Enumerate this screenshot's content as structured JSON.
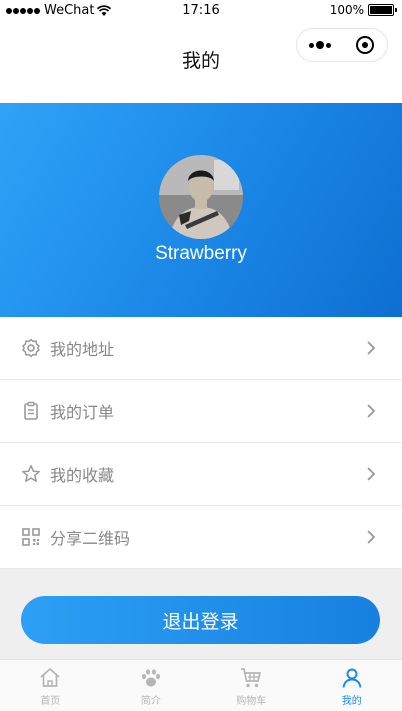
{
  "status_bar": {
    "carrier": "WeChat",
    "time": "17:16",
    "battery": "100%"
  },
  "nav": {
    "title": "我的"
  },
  "profile": {
    "username": "Strawberry"
  },
  "menu": {
    "items": [
      {
        "label": "我的地址",
        "icon": "settings-gear-icon"
      },
      {
        "label": "我的订单",
        "icon": "clipboard-icon"
      },
      {
        "label": "我的收藏",
        "icon": "star-icon"
      },
      {
        "label": "分享二维码",
        "icon": "qr-code-icon"
      }
    ]
  },
  "logout": {
    "label": "退出登录"
  },
  "tab_bar": {
    "tabs": [
      {
        "label": "首页",
        "icon": "home-icon"
      },
      {
        "label": "简介",
        "icon": "paw-icon"
      },
      {
        "label": "购物车",
        "icon": "cart-icon"
      },
      {
        "label": "我的",
        "icon": "user-icon",
        "active": true
      }
    ]
  },
  "colors": {
    "accent": "#1a8ae8",
    "header_gradient_start": "#2fa3f7",
    "header_gradient_end": "#0e6fd1",
    "inactive_tab": "#b5b5b5",
    "menu_text": "#888888"
  }
}
